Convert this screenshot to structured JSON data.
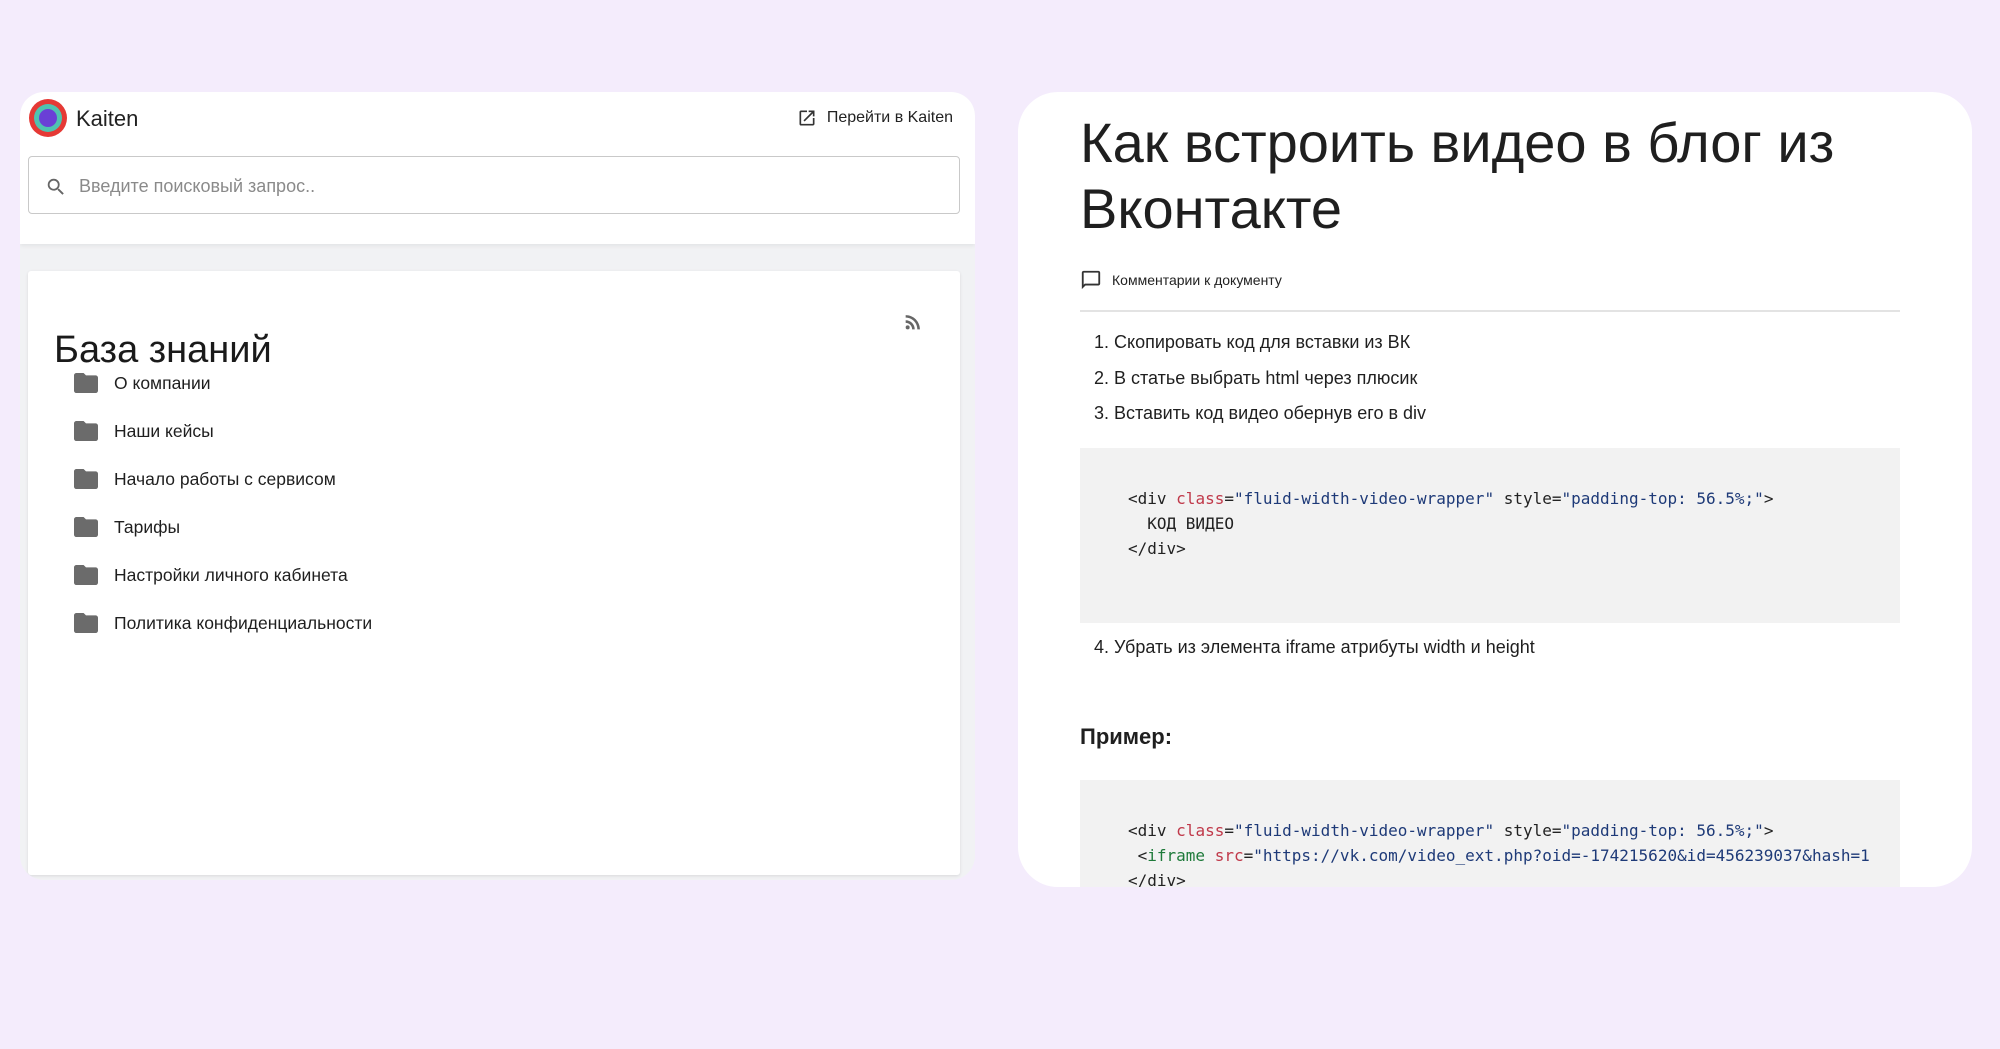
{
  "app": {
    "name": "Kaiten",
    "goto_label": "Перейти в Kaiten"
  },
  "search": {
    "placeholder": "Введите поисковый запрос..",
    "value": ""
  },
  "knowledge_base": {
    "title": "База знаний",
    "folders": [
      {
        "label": "О компании"
      },
      {
        "label": "Наши кейсы"
      },
      {
        "label": "Начало работы с сервисом"
      },
      {
        "label": "Тарифы"
      },
      {
        "label": "Настройки личного кабинета"
      },
      {
        "label": "Политика конфиденциальности"
      }
    ]
  },
  "article": {
    "title": "Как встроить видео в блог из Вконтакте",
    "comments_label": "Комментарии к документу",
    "steps": [
      "1. Скопировать код для вставки из ВК",
      "2. В статье выбрать html через плюсик",
      "3. Вставить код видео обернув его в div"
    ],
    "code1": {
      "line1_open": "<div ",
      "line1_attr1": "class",
      "line1_eq1": "=",
      "line1_val1": "\"fluid-width-video-wrapper\"",
      "line1_attr2": " style",
      "line1_eq2": "=",
      "line1_val2": "\"padding-top: 56.5%;\"",
      "line1_close": ">",
      "line2": "  КОД ВИДЕО",
      "line3": "</div>"
    },
    "step4": "4. Убрать из элемента iframe атрибуты width и height",
    "example_heading": "Пример:",
    "code2": {
      "line1_open": "<div ",
      "line1_attr1": "class",
      "line1_eq1": "=",
      "line1_val1": "\"fluid-width-video-wrapper\"",
      "line1_attr2": " style",
      "line1_eq2": "=",
      "line1_val2": "\"padding-top: 56.5%;\"",
      "line1_close": ">",
      "line2_open": " <",
      "line2_tag": "iframe",
      "line2_attr": " src",
      "line2_eq": "=",
      "line2_val": "\"https://vk.com/video_ext.php?oid=-174215620&id=456239037&hash=1",
      "line3": "</div>"
    }
  },
  "colors": {
    "page_background": "#f4ecfc",
    "code_background": "#f2f2f2",
    "attr_name": "#c0394a",
    "attr_value": "#1e3a78",
    "tag_name": "#1e7a3a"
  }
}
